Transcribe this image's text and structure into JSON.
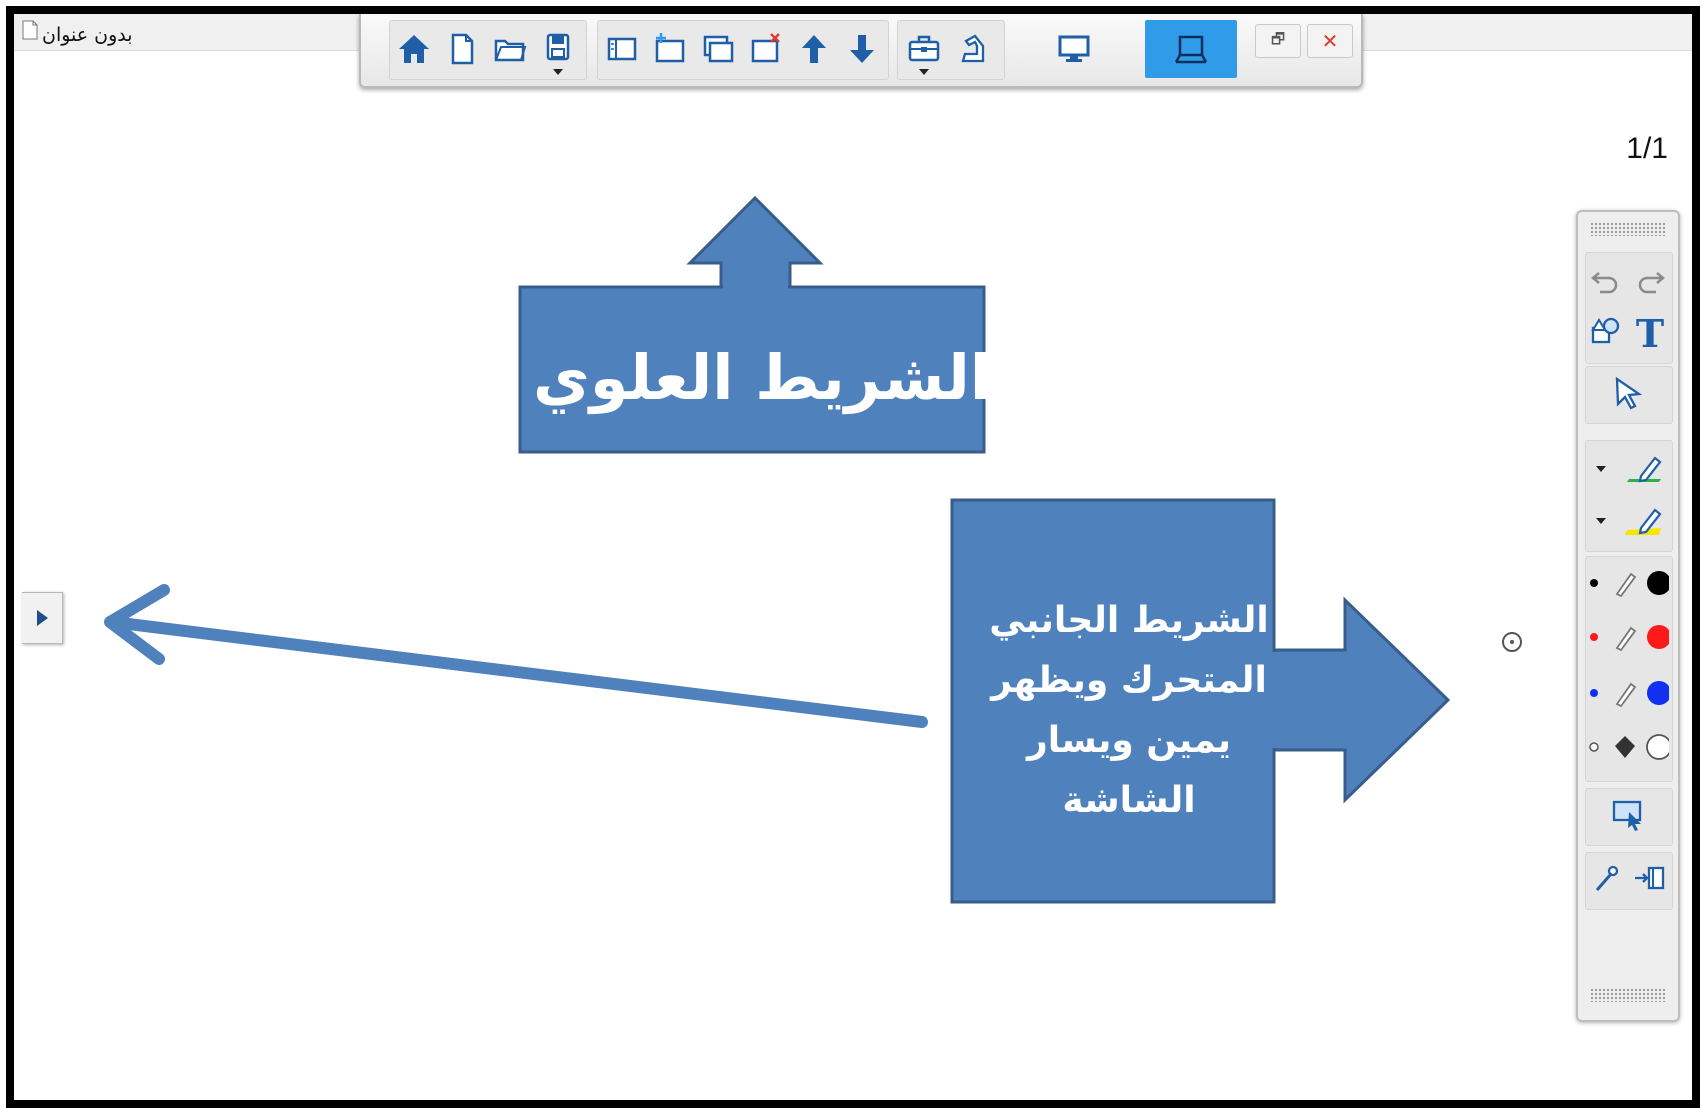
{
  "window": {
    "title": "بدون عنوان"
  },
  "toolbar": {
    "buttons": [
      {
        "name": "home-icon"
      },
      {
        "name": "new-file-icon"
      },
      {
        "name": "open-folder-icon"
      },
      {
        "name": "save-icon"
      },
      {
        "name": "page-panel-icon"
      },
      {
        "name": "add-page-icon"
      },
      {
        "name": "duplicate-page-icon"
      },
      {
        "name": "delete-page-icon"
      },
      {
        "name": "move-page-up-icon"
      },
      {
        "name": "move-page-down-icon"
      },
      {
        "name": "toolbox-icon"
      },
      {
        "name": "sign-tool-icon"
      },
      {
        "name": "desktop-mode-icon"
      },
      {
        "name": "whiteboard-mode-icon"
      }
    ],
    "active_mode": "whiteboard-mode",
    "restore_symbol": "🗗",
    "close_symbol": "✕"
  },
  "page_indicator": "1/1",
  "annotations": {
    "top_label": "الشريط العلوي",
    "side_label_lines": [
      "الشريط الجانبي",
      "المتحرك ويظهر",
      "يمين ويسار",
      "الشاشة"
    ]
  },
  "side_panel": {
    "tools": [
      "undo-icon",
      "redo-icon",
      "shapes-icon",
      "text-icon",
      "select-pointer-icon",
      "green-highlighter-icon",
      "yellow-highlighter-icon",
      "black-pen-icon",
      "red-pen-icon",
      "blue-pen-icon",
      "eraser-icon",
      "screen-capture-icon",
      "magic-pen-icon",
      "dock-panel-icon"
    ],
    "text_tool_glyph": "T",
    "pen_colors": {
      "black": "#000000",
      "red": "#ff1a1a",
      "blue": "#1230f0"
    },
    "highlighter_colors": {
      "green": "#2bb34a",
      "yellow": "#f5e600"
    }
  },
  "colors": {
    "callout_fill": "#4f81bd",
    "callout_border": "#385d8a",
    "toolbar_icon": "#1e5fa8",
    "active_mode": "#2f9be9",
    "close_red": "#e03a2f"
  }
}
